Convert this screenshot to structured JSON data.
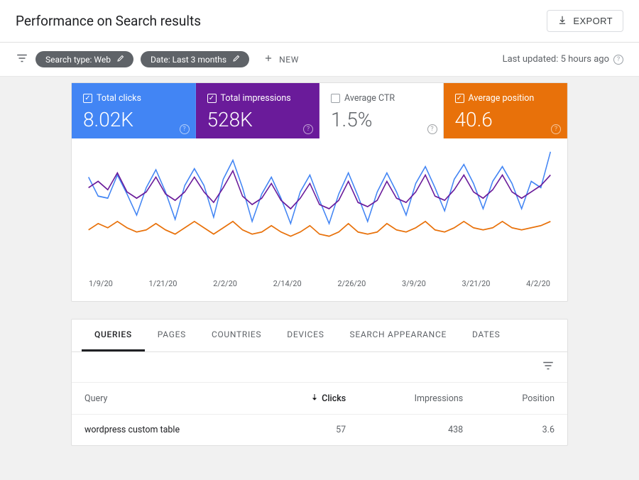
{
  "header": {
    "title": "Performance on Search results",
    "export_label": "EXPORT"
  },
  "filters": {
    "search_type_label": "Search type: Web",
    "date_label": "Date: Last 3 months",
    "new_label": "NEW",
    "last_updated": "Last updated: 5 hours ago"
  },
  "metrics": [
    {
      "label": "Total clicks",
      "value": "8.02K",
      "checked": true,
      "color": "blue"
    },
    {
      "label": "Total impressions",
      "value": "528K",
      "checked": true,
      "color": "purple"
    },
    {
      "label": "Average CTR",
      "value": "1.5%",
      "checked": false,
      "color": "off"
    },
    {
      "label": "Average position",
      "value": "40.6",
      "checked": true,
      "color": "orange"
    }
  ],
  "tabs": [
    "QUERIES",
    "PAGES",
    "COUNTRIES",
    "DEVICES",
    "SEARCH APPEARANCE",
    "DATES"
  ],
  "active_tab": "QUERIES",
  "table": {
    "columns": {
      "query": "Query",
      "clicks": "Clicks",
      "impressions": "Impressions",
      "position": "Position"
    },
    "rows": [
      {
        "query": "wordpress custom table",
        "clicks": "57",
        "impressions": "438",
        "position": "3.6"
      }
    ]
  },
  "chart_data": {
    "type": "line",
    "xlabel": "",
    "ylabel": "",
    "x_ticks": [
      "1/9/20",
      "1/21/20",
      "2/2/20",
      "2/14/20",
      "2/26/20",
      "3/9/20",
      "3/21/20",
      "4/2/20"
    ],
    "series": [
      {
        "name": "Total clicks",
        "color": "#4285f4",
        "values": [
          88,
          70,
          68,
          90,
          72,
          52,
          78,
          95,
          74,
          48,
          80,
          96,
          80,
          50,
          86,
          104,
          78,
          46,
          72,
          88,
          68,
          44,
          74,
          90,
          66,
          44,
          72,
          92,
          70,
          46,
          74,
          92,
          74,
          52,
          82,
          98,
          78,
          56,
          86,
          100,
          82,
          58,
          84,
          98,
          82,
          58,
          84,
          78,
          112
        ]
      },
      {
        "name": "Total impressions",
        "color": "#6a1b9a",
        "values": [
          78,
          84,
          76,
          92,
          74,
          68,
          74,
          88,
          72,
          66,
          74,
          88,
          74,
          64,
          78,
          94,
          70,
          62,
          68,
          82,
          66,
          58,
          68,
          82,
          62,
          58,
          66,
          84,
          64,
          60,
          66,
          84,
          68,
          64,
          74,
          90,
          70,
          66,
          76,
          90,
          74,
          68,
          76,
          90,
          74,
          68,
          74,
          80,
          90
        ]
      },
      {
        "name": "Average position",
        "color": "#e8710a",
        "values": [
          38,
          44,
          40,
          46,
          40,
          36,
          38,
          44,
          38,
          34,
          40,
          46,
          40,
          34,
          40,
          46,
          38,
          34,
          36,
          42,
          36,
          32,
          36,
          42,
          34,
          32,
          36,
          44,
          36,
          34,
          36,
          44,
          38,
          36,
          40,
          46,
          38,
          36,
          40,
          46,
          40,
          38,
          40,
          46,
          40,
          38,
          40,
          42,
          46
        ]
      }
    ]
  }
}
